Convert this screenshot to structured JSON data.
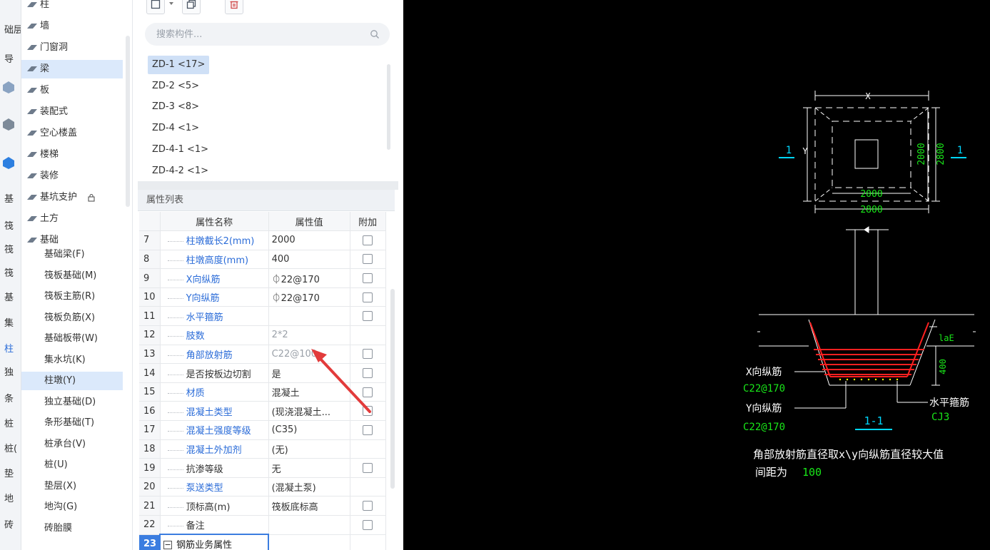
{
  "left_strip": {
    "items": [
      {
        "label": "础层",
        "active": false
      },
      {
        "label": "导",
        "active": false
      },
      {
        "label": "基",
        "active": false
      },
      {
        "label": "筏",
        "active": false
      },
      {
        "label": "筏",
        "active": false
      },
      {
        "label": "筏",
        "active": false
      },
      {
        "label": "基",
        "active": false
      },
      {
        "label": "集",
        "active": false
      },
      {
        "label": "柱",
        "active": true
      },
      {
        "label": "独",
        "active": false
      },
      {
        "label": "条",
        "active": false
      },
      {
        "label": "桩",
        "active": false
      },
      {
        "label": "桩(",
        "active": false
      },
      {
        "label": "垫",
        "active": false
      },
      {
        "label": "地",
        "active": false
      },
      {
        "label": "砖",
        "active": false
      }
    ]
  },
  "tree": {
    "top_items": [
      {
        "label": "柱",
        "icon": "column-icon"
      },
      {
        "label": "墙",
        "icon": "wall-icon"
      },
      {
        "label": "门窗洞",
        "icon": "door-window-icon"
      },
      {
        "label": "梁",
        "icon": "beam-icon"
      },
      {
        "label": "板",
        "icon": "slab-icon"
      },
      {
        "label": "装配式",
        "icon": "prefab-icon"
      },
      {
        "label": "空心楼盖",
        "icon": "hollow-floor-icon"
      },
      {
        "label": "楼梯",
        "icon": "stair-icon"
      },
      {
        "label": "装修",
        "icon": "decoration-icon"
      },
      {
        "label": "基坑支护",
        "icon": "pit-support-icon"
      },
      {
        "label": "土方",
        "icon": "earthwork-icon"
      },
      {
        "label": "基础",
        "icon": "foundation-icon"
      }
    ],
    "lock_icon": "lock-icon",
    "children": [
      "基础梁(F)",
      "筏板基础(M)",
      "筏板主筋(R)",
      "筏板负筋(X)",
      "基础板带(W)",
      "集水坑(K)",
      "柱墩(Y)",
      "独立基础(D)",
      "条形基础(T)",
      "桩承台(V)",
      "桩(U)",
      "垫层(X)",
      "地沟(G)",
      "砖胎膜"
    ],
    "selected_child": "柱墩(Y)"
  },
  "toolbar": {
    "new_icon": "new-component-icon",
    "dropdown_icon": "chevron-down-icon",
    "copy_icon": "copy-icon",
    "delete_icon": "delete-icon"
  },
  "search": {
    "placeholder": "搜索构件...",
    "value": ""
  },
  "components": [
    {
      "label": "ZD-1 <17>",
      "selected": true
    },
    {
      "label": "ZD-2 <5>",
      "selected": false
    },
    {
      "label": "ZD-3 <8>",
      "selected": false
    },
    {
      "label": "ZD-4 <1>",
      "selected": false
    },
    {
      "label": "ZD-4-1 <1>",
      "selected": false
    },
    {
      "label": "ZD-4-2 <1>",
      "selected": false
    }
  ],
  "properties": {
    "title": "属性列表",
    "headers": [
      "属性名称",
      "属性值",
      "附加"
    ],
    "rows": [
      {
        "num": "7",
        "name": "柱墩截长2(mm)",
        "value": "2000",
        "checkbox": true,
        "name_color": "blue",
        "grey": false
      },
      {
        "num": "8",
        "name": "柱墩高度(mm)",
        "value": "400",
        "checkbox": true,
        "name_color": "blue",
        "grey": false
      },
      {
        "num": "9",
        "name": "X向纵筋",
        "value": "⏀22@170",
        "checkbox": true,
        "name_color": "blue",
        "grey": false
      },
      {
        "num": "10",
        "name": "Y向纵筋",
        "value": "⏀22@170",
        "checkbox": true,
        "name_color": "blue",
        "grey": false
      },
      {
        "num": "11",
        "name": "水平箍筋",
        "value": "",
        "checkbox": true,
        "name_color": "blue",
        "grey": false
      },
      {
        "num": "12",
        "name": "肢数",
        "value": "2*2",
        "checkbox": false,
        "name_color": "blue",
        "grey": true
      },
      {
        "num": "13",
        "name": "角部放射筋",
        "value": "C22@100",
        "checkbox": true,
        "name_color": "blue",
        "grey": true
      },
      {
        "num": "14",
        "name": "是否按板边切割",
        "value": "是",
        "checkbox": true,
        "name_color": "black",
        "grey": false
      },
      {
        "num": "15",
        "name": "材质",
        "value": "混凝土",
        "checkbox": true,
        "name_color": "blue",
        "grey": false
      },
      {
        "num": "16",
        "name": "混凝土类型",
        "value": "(现浇混凝土...",
        "checkbox": true,
        "name_color": "blue",
        "grey": false
      },
      {
        "num": "17",
        "name": "混凝土强度等级",
        "value": "(C35)",
        "checkbox": true,
        "name_color": "blue",
        "grey": false
      },
      {
        "num": "18",
        "name": "混凝土外加剂",
        "value": "(无)",
        "checkbox": false,
        "name_color": "blue",
        "grey": false
      },
      {
        "num": "19",
        "name": "抗渗等级",
        "value": "无",
        "checkbox": true,
        "name_color": "black",
        "grey": false
      },
      {
        "num": "20",
        "name": "泵送类型",
        "value": "(混凝土泵)",
        "checkbox": false,
        "name_color": "blue",
        "grey": false
      },
      {
        "num": "21",
        "name": "顶标高(m)",
        "value": "筏板底标高",
        "checkbox": true,
        "name_color": "black",
        "grey": false
      },
      {
        "num": "22",
        "name": "备注",
        "value": "",
        "checkbox": true,
        "name_color": "black",
        "grey": false
      }
    ],
    "group_row": {
      "num": "23",
      "label": "钢筋业务属性",
      "toggle": "−"
    }
  },
  "cad": {
    "plan": {
      "x_label": "X",
      "y_label": "Y",
      "section_mark": "1",
      "dim_inner_h": "2000",
      "dim_outer_h": "2800",
      "dim_inner_v": "2000",
      "dim_outer_v": "2800"
    },
    "section": {
      "lae": "laE",
      "height": "400",
      "x_rebar_label": "X向纵筋",
      "x_rebar_value": "C22@170",
      "y_rebar_label": "Y向纵筋",
      "y_rebar_value": "C22@170",
      "hoop_label": "水平箍筋",
      "hoop_value": "CJ3",
      "section_name": "1-1"
    },
    "note_line1": "角部放射筋直径取x\\y向纵筋直径较大值",
    "note_line2_prefix": "间距为",
    "note_line2_value": "100"
  },
  "colors": {
    "accent": "#2b6cd8",
    "selected_bg": "#cfe0f6",
    "cad_bg": "#000000",
    "cad_white": "#ffffff",
    "cad_green": "#19e619",
    "cad_cyan": "#00d7ff",
    "cad_red": "#ff2020",
    "cad_yellow": "#ffff00",
    "annotation_arrow": "#e23b3b"
  }
}
